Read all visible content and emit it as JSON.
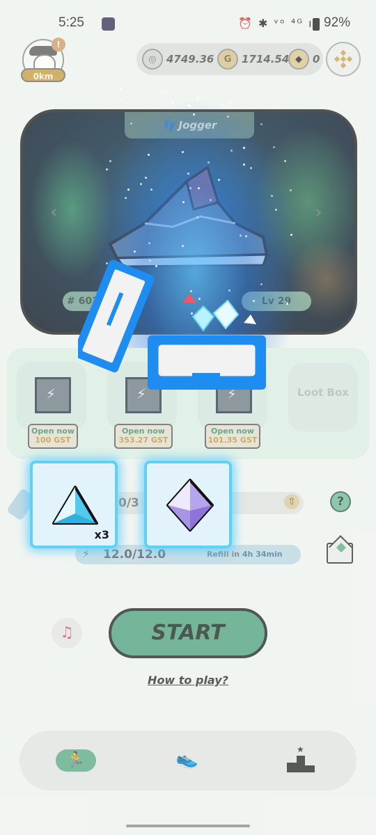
{
  "status_bar": {
    "time": "5:25",
    "icons": "⏰ ✱ ᵛᵒ ⁴ᴳ ıll",
    "battery": "92%"
  },
  "profile": {
    "distance": "0km",
    "notification_badge": "!"
  },
  "balances": {
    "gmt": "4749.36",
    "gst": "1714.54",
    "bnb": "0"
  },
  "sneaker": {
    "class": "Jogger",
    "id": "# 60318",
    "level": "Lv 29"
  },
  "mystery_boxes": [
    {
      "label": "Open now",
      "price": "100 GST"
    },
    {
      "label": "Open now",
      "price": "353.27 GST"
    },
    {
      "label": "Open now",
      "price": "101.35 GST"
    }
  ],
  "loot_box": "Loot Box",
  "durability": {
    "text": "0/3"
  },
  "energy": {
    "value": "12.0/12.0",
    "refill_label": "Refill in ",
    "refill_time": "4h 34min"
  },
  "start_label": "START",
  "how_to_play": "How to play?",
  "rewards": [
    {
      "item": "gem-tetrahedron-blue",
      "quantity": "x3",
      "color": "#4cc6ee"
    },
    {
      "item": "gem-octahedron-purple",
      "quantity": "",
      "color": "#a48ce0"
    }
  ],
  "colors": {
    "accent_green": "#4fa07e",
    "reward_border": "#5fd2f4",
    "box_blue": "#1f8cf0"
  }
}
